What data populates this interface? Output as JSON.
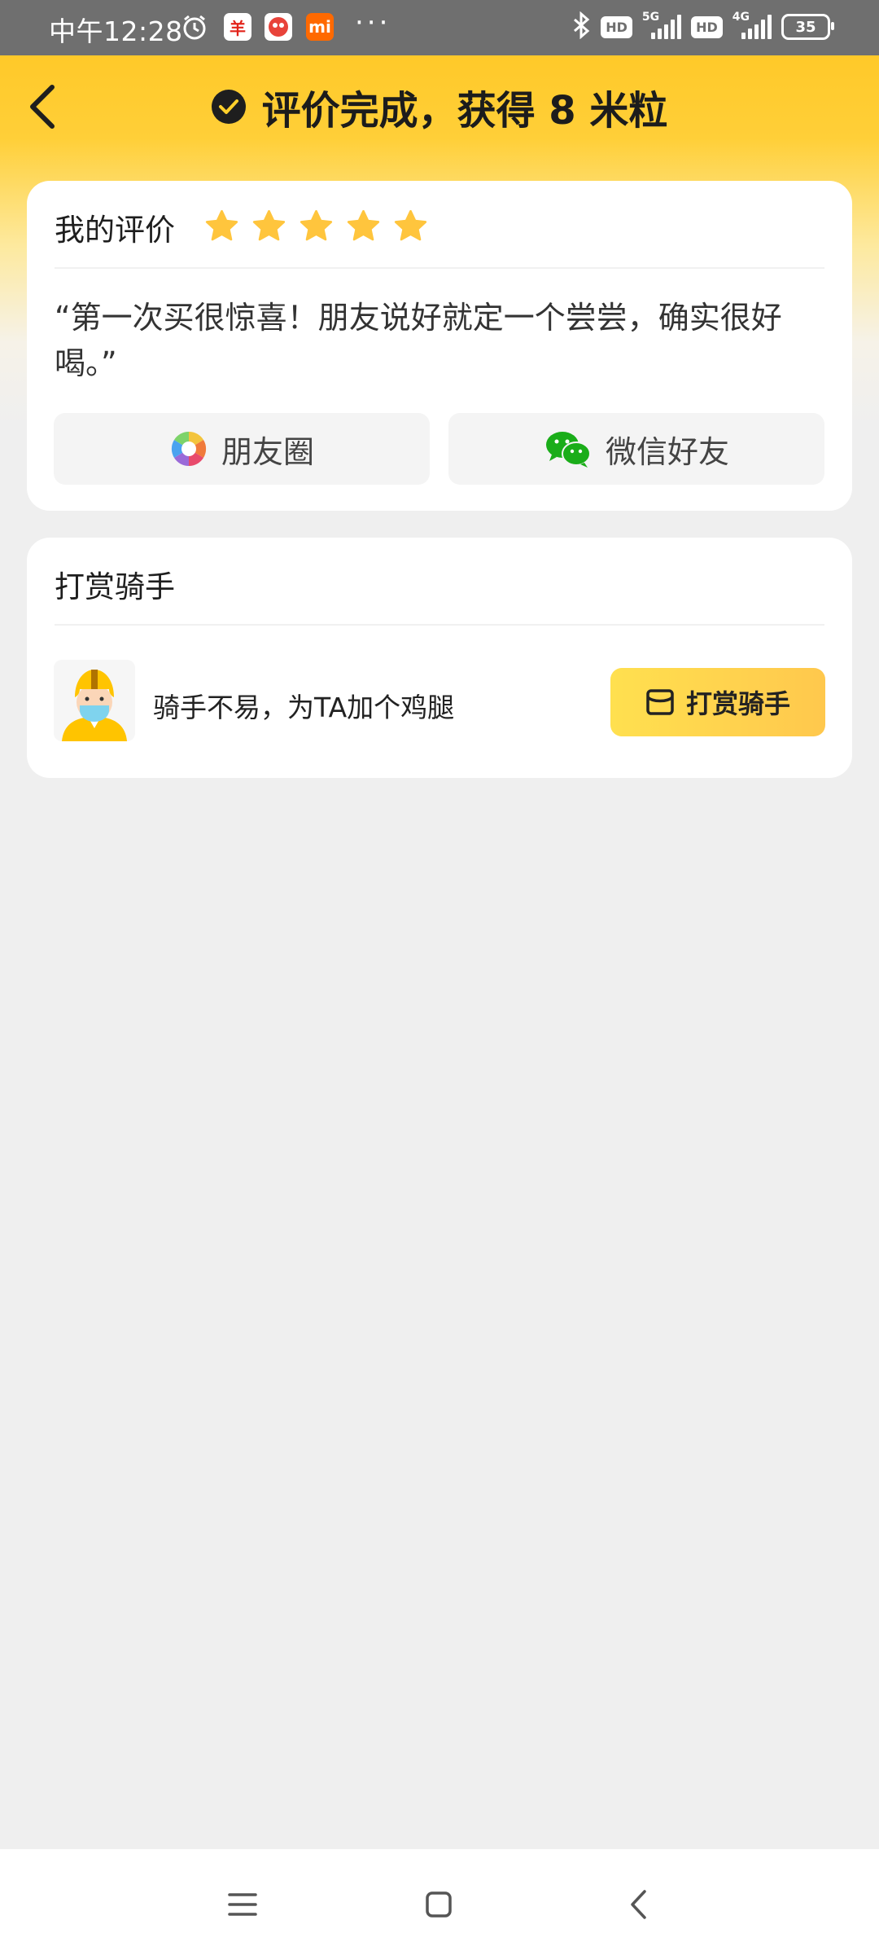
{
  "status_bar": {
    "time": "中午12:28",
    "dots": "···",
    "hd1": "HD",
    "net1": "5G",
    "hd2": "HD",
    "net2": "4G",
    "battery": "35",
    "app_icons": [
      "alarm-icon",
      "taobao-style-app-icon",
      "game-app-icon",
      "mi-app-icon"
    ]
  },
  "header": {
    "title": "评价完成，获得 8 米粒",
    "accent_color": "#ffc51f"
  },
  "review_card": {
    "title": "我的评价",
    "rating": 5,
    "rating_max": 5,
    "review_text": "“第一次买很惊喜！朋友说好就定一个尝尝，确实很好喝。”",
    "share_moments_label": "朋友圈",
    "share_wechat_label": "微信好友"
  },
  "tip_card": {
    "title": "打赏骑手",
    "description": "骑手不易，为TA加个鸡腿",
    "button_label": "打赏骑手"
  },
  "nav_bar": {
    "items": [
      "menu-icon",
      "home-icon",
      "back-icon"
    ]
  }
}
